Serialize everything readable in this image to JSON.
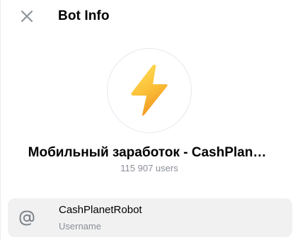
{
  "header": {
    "title": "Bot Info",
    "close_icon": "close-icon"
  },
  "profile": {
    "avatar_icon": "lightning-icon",
    "name": "Мобильный заработок - CashPlan…",
    "subtitle": "115 907 users"
  },
  "info": {
    "icon": "at-sign-icon",
    "value": "CashPlanetRobot",
    "label": "Username"
  },
  "colors": {
    "lightning_top": "#ffd84a",
    "lightning_bottom": "#f3a12a",
    "secondary_text": "#8a8f96",
    "row_background": "#f1f1f2"
  }
}
